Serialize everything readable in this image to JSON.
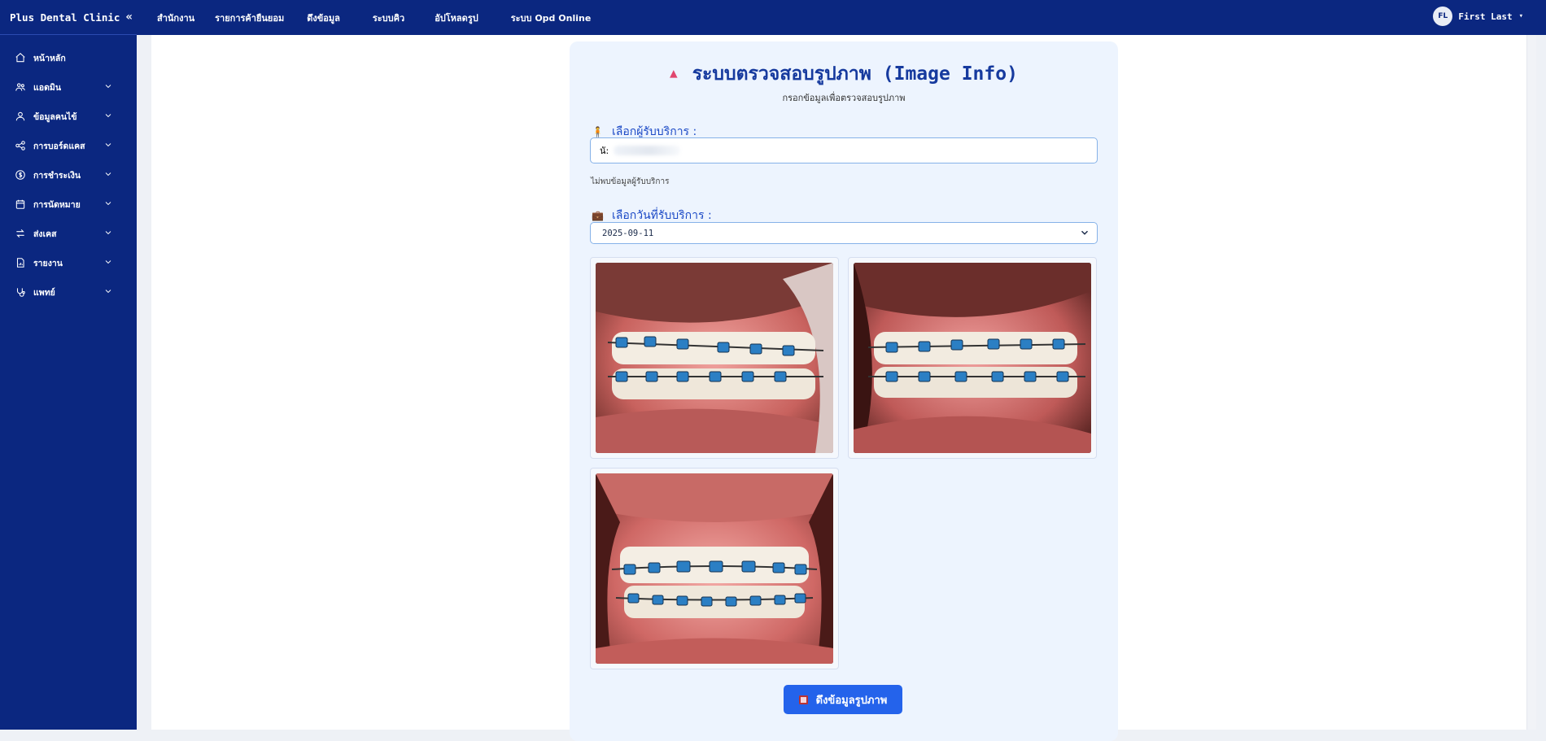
{
  "app": {
    "brand": "Plus Dental Clinic",
    "collapse_icon": "double-chevron-left-icon"
  },
  "topnav": [
    {
      "label": "สำนักงาน"
    },
    {
      "label": "รายการค้ายืนยอม"
    },
    {
      "label": "ดึงข้อมูล"
    },
    {
      "label": "ระบบคิว"
    },
    {
      "label": "อัปโหลดรูป"
    },
    {
      "label": "ระบบ Opd Online"
    }
  ],
  "user": {
    "initials": "FL",
    "name": "First Last"
  },
  "sidebar": {
    "items": [
      {
        "label": "หน้าหลัก",
        "icon": "home-icon",
        "has_arrow": false
      },
      {
        "label": "แอดมิน",
        "icon": "users-icon",
        "has_arrow": true
      },
      {
        "label": "ข้อมูลคนไข้",
        "icon": "user-icon",
        "has_arrow": true
      },
      {
        "label": "การบอร์ดแคส",
        "icon": "share-icon",
        "has_arrow": true
      },
      {
        "label": "การชำระเงิน",
        "icon": "dollar-icon",
        "has_arrow": true
      },
      {
        "label": "การนัดหมาย",
        "icon": "calendar-icon",
        "has_arrow": true
      },
      {
        "label": "ส่งเคส",
        "icon": "transfer-icon",
        "has_arrow": true
      },
      {
        "label": "รายงาน",
        "icon": "report-icon",
        "has_arrow": true
      },
      {
        "label": "แพทย์",
        "icon": "stethoscope-icon",
        "has_arrow": true
      }
    ]
  },
  "card": {
    "title": "ระบบตรวจสอบรูปภาพ (Image Info)",
    "subtitle": "กรอกข้อมูลเพื่อตรวจสอบรูปภาพ",
    "patient_label": "เลือกผู้รับบริการ  :",
    "patient_value": "นั:",
    "not_found": "ไม่พบข้อมูลผู้รับบริการ",
    "date_label": "เลือกวันที่รับบริการ  :",
    "date_value": "2025-09-11",
    "images": [
      {
        "alt": "ภาพฟันด้านขวา"
      },
      {
        "alt": "ภาพฟันด้านซ้าย"
      },
      {
        "alt": "ภาพฟันด้านหน้า"
      }
    ],
    "fetch_button": "ดึงข้อมูลรูปภาพ"
  },
  "colors": {
    "navy": "#0b2780",
    "accent": "#2463eb",
    "card_bg": "#edf4fe",
    "title": "#163a9e",
    "triangle": "#e0466e"
  }
}
